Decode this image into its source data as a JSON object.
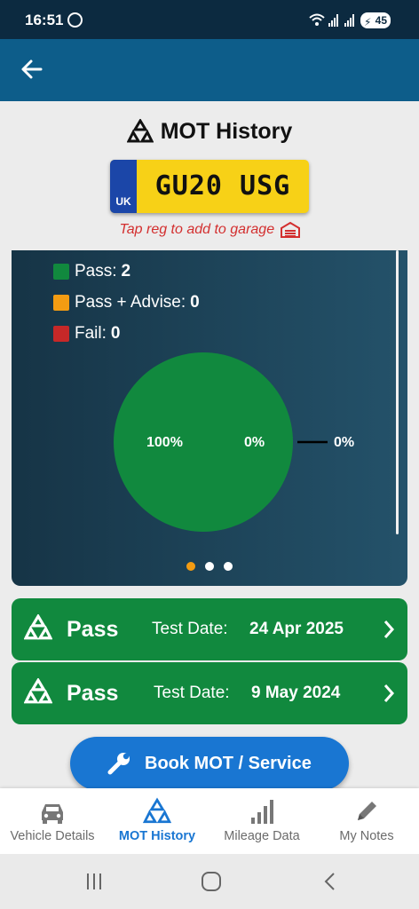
{
  "status_bar": {
    "time": "16:51",
    "battery": "45"
  },
  "header": {
    "title": "MOT History"
  },
  "vehicle": {
    "country_code": "UK",
    "registration": "GU20 USG",
    "tap_hint": "Tap reg to add to garage"
  },
  "summary": {
    "legend": [
      {
        "label": "Pass:",
        "value": "2",
        "color": "#11893e"
      },
      {
        "label": "Pass + Advise:",
        "value": "0",
        "color": "#f39c12"
      },
      {
        "label": "Fail:",
        "value": "0",
        "color": "#c62828"
      }
    ],
    "pie_labels": [
      "100%",
      "0%",
      "0%"
    ],
    "page_indicator": {
      "pages": 3,
      "active_index": 0
    }
  },
  "chart_data": {
    "type": "pie",
    "categories": [
      "Pass",
      "Pass + Advise",
      "Fail"
    ],
    "values": [
      2,
      0,
      0
    ],
    "percent_labels": [
      "100%",
      "0%",
      "0%"
    ]
  },
  "tests": [
    {
      "result": "Pass",
      "date_label": "Test Date:",
      "date": "24 Apr 2025"
    },
    {
      "result": "Pass",
      "date_label": "Test Date:",
      "date": "9 May 2024"
    }
  ],
  "actions": {
    "book_label": "Book MOT / Service"
  },
  "bottom_nav": [
    {
      "label": "Vehicle Details",
      "icon": "car-icon",
      "active": false
    },
    {
      "label": "MOT History",
      "icon": "mot-triangle-icon",
      "active": true
    },
    {
      "label": "Mileage Data",
      "icon": "bar-signal-icon",
      "active": false
    },
    {
      "label": "My Notes",
      "icon": "pencil-icon",
      "active": false
    }
  ],
  "colors": {
    "accent": "#1976d2",
    "pass": "#11893e",
    "appbar": "#0d5d8a",
    "hint": "#d32f2f"
  }
}
